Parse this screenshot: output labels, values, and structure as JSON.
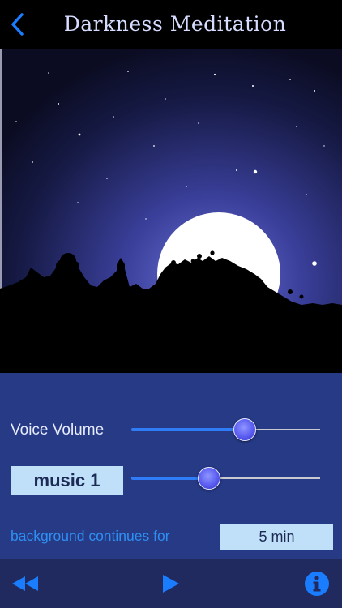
{
  "nav": {
    "title": "Darkness Meditation",
    "back_icon": "chevron-left-icon"
  },
  "controls": {
    "voice_volume_label": "Voice Volume",
    "voice_volume_level": 0.6,
    "music_button_label": "music 1",
    "music_volume_level": 0.41,
    "background_label": "background continues for",
    "duration_value": "5 min"
  },
  "toolbar": {
    "rewind_icon": "rewind-icon",
    "play_icon": "play-icon",
    "info_icon": "info-icon"
  },
  "colors": {
    "accent": "#2f7cf6",
    "panel": "#263a86",
    "toolbar": "#202a5e",
    "value_box": "#bfe0f8"
  }
}
